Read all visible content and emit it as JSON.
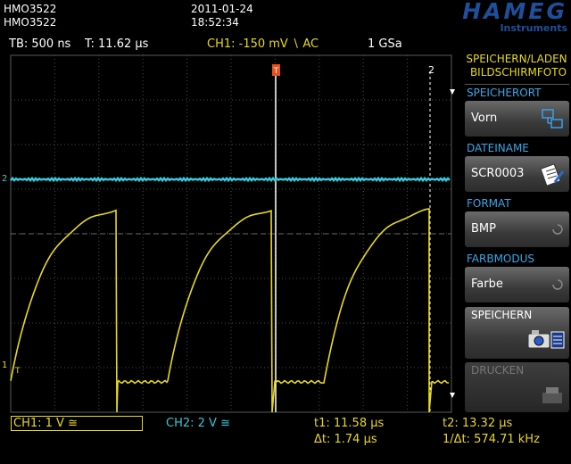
{
  "header": {
    "device_line1": "HMO3522",
    "device_line2": "HMO3522",
    "date": "2011-01-24",
    "time": "18:52:34",
    "logo_main": "HAMEG",
    "logo_sub": "Instruments"
  },
  "status": {
    "timebase": "TB: 500 ns",
    "trigger_time": "T: 11.62 µs",
    "ch1_trigger": "CH1: -150 mV ∖ AC",
    "samplerate": "1 GSa"
  },
  "markers": {
    "trigger_label": "T",
    "cursor2": "2",
    "ch2_marker": "2",
    "ch1_marker": "1",
    "ch1_trigger_mark": "T"
  },
  "menu": {
    "title_line1": "SPEICHERN/LADEN",
    "title_line2": "BILDSCHIRMFOTO",
    "location_label": "SPEICHERORT",
    "location_value": "Vorn",
    "filename_label": "DATEINAME",
    "filename_value": "SCR0003",
    "format_label": "FORMAT",
    "format_value": "BMP",
    "colormode_label": "FARBMODUS",
    "colormode_value": "Farbe",
    "save_label": "SPEICHERN",
    "print_label": "DRUCKEN"
  },
  "bottom": {
    "ch1": "CH1: 1 V ≅",
    "ch2": "CH2: 2 V ≅",
    "t1": "t1: 11.58 µs",
    "t2": "t2: 13.32 µs",
    "dt": "Δt: 1.74 µs",
    "inv_dt": "1/Δt: 574.71 kHz"
  },
  "colors": {
    "ch1": "#e8d820",
    "ch2": "#38c8d8",
    "accent_blue": "#38a8e8",
    "grid": "#5a5a5a"
  }
}
